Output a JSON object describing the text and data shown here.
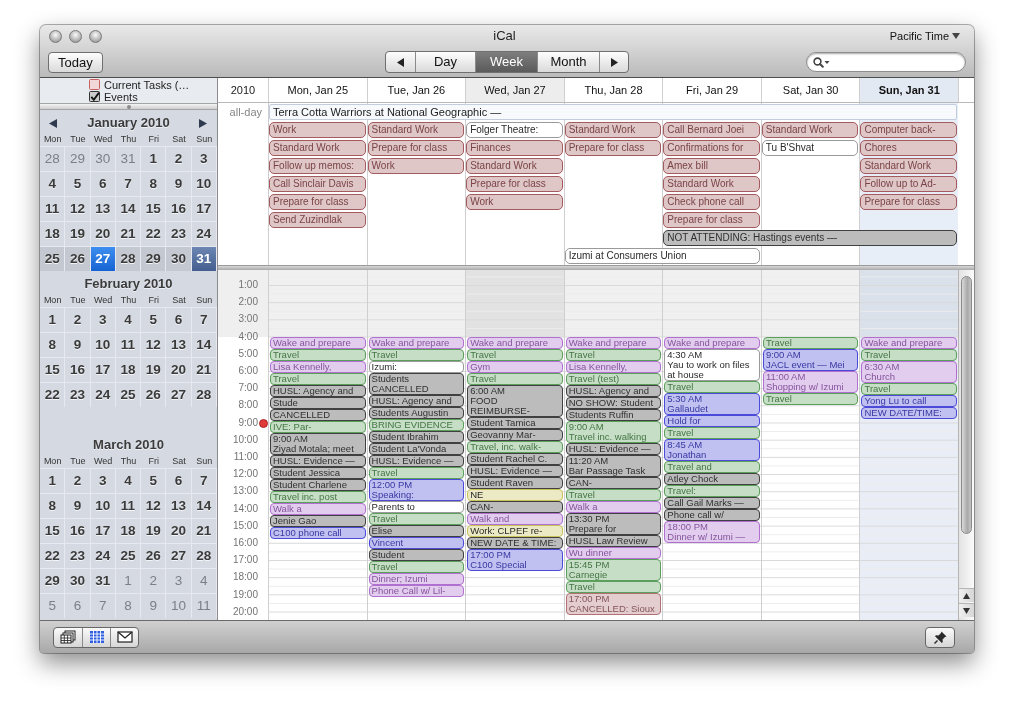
{
  "window": {
    "title": "iCal"
  },
  "toolbar": {
    "today": "Today",
    "views": [
      {
        "label": "Day",
        "selected": false
      },
      {
        "label": "Week",
        "selected": true
      },
      {
        "label": "Month",
        "selected": false
      }
    ],
    "time_zone": "Pacific Time"
  },
  "sidebar": {
    "calendars": [
      {
        "title": "Current Tasks (…",
        "checked": false,
        "color": "#c86060"
      },
      {
        "title": "Events",
        "checked": true,
        "color": "#333333"
      }
    ],
    "months": [
      {
        "title": "January 2010",
        "weekdays": [
          "Mon",
          "Tue",
          "Wed",
          "Thu",
          "Fri",
          "Sat",
          "Sun"
        ],
        "weeks": [
          {
            "in_view": false,
            "days": [
              {
                "label": "28",
                "outside": true,
                "today": false,
                "selected": false
              },
              {
                "label": "29",
                "outside": true,
                "today": false,
                "selected": false
              },
              {
                "label": "30",
                "outside": true,
                "today": false,
                "selected": false
              },
              {
                "label": "31",
                "outside": true,
                "today": false,
                "selected": false
              },
              {
                "label": "1",
                "outside": false,
                "today": false,
                "selected": false
              },
              {
                "label": "2",
                "outside": false,
                "today": false,
                "selected": false
              },
              {
                "label": "3",
                "outside": false,
                "today": false,
                "selected": false
              }
            ]
          },
          {
            "in_view": false,
            "days": [
              {
                "label": "4",
                "outside": false,
                "today": false,
                "selected": false
              },
              {
                "label": "5",
                "outside": false,
                "today": false,
                "selected": false
              },
              {
                "label": "6",
                "outside": false,
                "today": false,
                "selected": false
              },
              {
                "label": "7",
                "outside": false,
                "today": false,
                "selected": false
              },
              {
                "label": "8",
                "outside": false,
                "today": false,
                "selected": false
              },
              {
                "label": "9",
                "outside": false,
                "today": false,
                "selected": false
              },
              {
                "label": "10",
                "outside": false,
                "today": false,
                "selected": false
              }
            ]
          },
          {
            "in_view": false,
            "days": [
              {
                "label": "11",
                "outside": false,
                "today": false,
                "selected": false
              },
              {
                "label": "12",
                "outside": false,
                "today": false,
                "selected": false
              },
              {
                "label": "13",
                "outside": false,
                "today": false,
                "selected": false
              },
              {
                "label": "14",
                "outside": false,
                "today": false,
                "selected": false
              },
              {
                "label": "15",
                "outside": false,
                "today": false,
                "selected": false
              },
              {
                "label": "16",
                "outside": false,
                "today": false,
                "selected": false
              },
              {
                "label": "17",
                "outside": false,
                "today": false,
                "selected": false
              }
            ]
          },
          {
            "in_view": false,
            "days": [
              {
                "label": "18",
                "outside": false,
                "today": false,
                "selected": false
              },
              {
                "label": "19",
                "outside": false,
                "today": false,
                "selected": false
              },
              {
                "label": "20",
                "outside": false,
                "today": false,
                "selected": false
              },
              {
                "label": "21",
                "outside": false,
                "today": false,
                "selected": false
              },
              {
                "label": "22",
                "outside": false,
                "today": false,
                "selected": false
              },
              {
                "label": "23",
                "outside": false,
                "today": false,
                "selected": false
              },
              {
                "label": "24",
                "outside": false,
                "today": false,
                "selected": false
              }
            ]
          },
          {
            "in_view": true,
            "days": [
              {
                "label": "25",
                "outside": false,
                "today": false,
                "selected": false
              },
              {
                "label": "26",
                "outside": false,
                "today": false,
                "selected": false
              },
              {
                "label": "27",
                "outside": false,
                "today": true,
                "selected": false
              },
              {
                "label": "28",
                "outside": false,
                "today": false,
                "selected": false
              },
              {
                "label": "29",
                "outside": false,
                "today": false,
                "selected": false
              },
              {
                "label": "30",
                "outside": false,
                "today": false,
                "selected": false
              },
              {
                "label": "31",
                "outside": false,
                "today": false,
                "selected": true
              }
            ]
          }
        ]
      },
      {
        "title": "February 2010",
        "weekdays": [
          "Mon",
          "Tue",
          "Wed",
          "Thu",
          "Fri",
          "Sat",
          "Sun"
        ],
        "weeks": [
          {
            "in_view": false,
            "days": [
              {
                "label": "1",
                "outside": false,
                "today": false,
                "selected": false
              },
              {
                "label": "2",
                "outside": false,
                "today": false,
                "selected": false
              },
              {
                "label": "3",
                "outside": false,
                "today": false,
                "selected": false
              },
              {
                "label": "4",
                "outside": false,
                "today": false,
                "selected": false
              },
              {
                "label": "5",
                "outside": false,
                "today": false,
                "selected": false
              },
              {
                "label": "6",
                "outside": false,
                "today": false,
                "selected": false
              },
              {
                "label": "7",
                "outside": false,
                "today": false,
                "selected": false
              }
            ]
          },
          {
            "in_view": false,
            "days": [
              {
                "label": "8",
                "outside": false,
                "today": false,
                "selected": false
              },
              {
                "label": "9",
                "outside": false,
                "today": false,
                "selected": false
              },
              {
                "label": "10",
                "outside": false,
                "today": false,
                "selected": false
              },
              {
                "label": "11",
                "outside": false,
                "today": false,
                "selected": false
              },
              {
                "label": "12",
                "outside": false,
                "today": false,
                "selected": false
              },
              {
                "label": "13",
                "outside": false,
                "today": false,
                "selected": false
              },
              {
                "label": "14",
                "outside": false,
                "today": false,
                "selected": false
              }
            ]
          },
          {
            "in_view": false,
            "days": [
              {
                "label": "15",
                "outside": false,
                "today": false,
                "selected": false
              },
              {
                "label": "16",
                "outside": false,
                "today": false,
                "selected": false
              },
              {
                "label": "17",
                "outside": false,
                "today": false,
                "selected": false
              },
              {
                "label": "18",
                "outside": false,
                "today": false,
                "selected": false
              },
              {
                "label": "19",
                "outside": false,
                "today": false,
                "selected": false
              },
              {
                "label": "20",
                "outside": false,
                "today": false,
                "selected": false
              },
              {
                "label": "21",
                "outside": false,
                "today": false,
                "selected": false
              }
            ]
          },
          {
            "in_view": false,
            "days": [
              {
                "label": "22",
                "outside": false,
                "today": false,
                "selected": false
              },
              {
                "label": "23",
                "outside": false,
                "today": false,
                "selected": false
              },
              {
                "label": "24",
                "outside": false,
                "today": false,
                "selected": false
              },
              {
                "label": "25",
                "outside": false,
                "today": false,
                "selected": false
              },
              {
                "label": "26",
                "outside": false,
                "today": false,
                "selected": false
              },
              {
                "label": "27",
                "outside": false,
                "today": false,
                "selected": false
              },
              {
                "label": "28",
                "outside": false,
                "today": false,
                "selected": false
              }
            ]
          }
        ]
      },
      {
        "title": "March 2010",
        "weekdays": [
          "Mon",
          "Tue",
          "Wed",
          "Thu",
          "Fri",
          "Sat",
          "Sun"
        ],
        "weeks": [
          {
            "in_view": false,
            "days": [
              {
                "label": "1",
                "outside": false,
                "today": false,
                "selected": false
              },
              {
                "label": "2",
                "outside": false,
                "today": false,
                "selected": false
              },
              {
                "label": "3",
                "outside": false,
                "today": false,
                "selected": false
              },
              {
                "label": "4",
                "outside": false,
                "today": false,
                "selected": false
              },
              {
                "label": "5",
                "outside": false,
                "today": false,
                "selected": false
              },
              {
                "label": "6",
                "outside": false,
                "today": false,
                "selected": false
              },
              {
                "label": "7",
                "outside": false,
                "today": false,
                "selected": false
              }
            ]
          },
          {
            "in_view": false,
            "days": [
              {
                "label": "8",
                "outside": false,
                "today": false,
                "selected": false
              },
              {
                "label": "9",
                "outside": false,
                "today": false,
                "selected": false
              },
              {
                "label": "10",
                "outside": false,
                "today": false,
                "selected": false
              },
              {
                "label": "11",
                "outside": false,
                "today": false,
                "selected": false
              },
              {
                "label": "12",
                "outside": false,
                "today": false,
                "selected": false
              },
              {
                "label": "13",
                "outside": false,
                "today": false,
                "selected": false
              },
              {
                "label": "14",
                "outside": false,
                "today": false,
                "selected": false
              }
            ]
          },
          {
            "in_view": false,
            "days": [
              {
                "label": "15",
                "outside": false,
                "today": false,
                "selected": false
              },
              {
                "label": "16",
                "outside": false,
                "today": false,
                "selected": false
              },
              {
                "label": "17",
                "outside": false,
                "today": false,
                "selected": false
              },
              {
                "label": "18",
                "outside": false,
                "today": false,
                "selected": false
              },
              {
                "label": "19",
                "outside": false,
                "today": false,
                "selected": false
              },
              {
                "label": "20",
                "outside": false,
                "today": false,
                "selected": false
              },
              {
                "label": "21",
                "outside": false,
                "today": false,
                "selected": false
              }
            ]
          },
          {
            "in_view": false,
            "days": [
              {
                "label": "22",
                "outside": false,
                "today": false,
                "selected": false
              },
              {
                "label": "23",
                "outside": false,
                "today": false,
                "selected": false
              },
              {
                "label": "24",
                "outside": false,
                "today": false,
                "selected": false
              },
              {
                "label": "25",
                "outside": false,
                "today": false,
                "selected": false
              },
              {
                "label": "26",
                "outside": false,
                "today": false,
                "selected": false
              },
              {
                "label": "27",
                "outside": false,
                "today": false,
                "selected": false
              },
              {
                "label": "28",
                "outside": false,
                "today": false,
                "selected": false
              }
            ]
          },
          {
            "in_view": false,
            "days": [
              {
                "label": "29",
                "outside": false,
                "today": false,
                "selected": false
              },
              {
                "label": "30",
                "outside": false,
                "today": false,
                "selected": false
              },
              {
                "label": "31",
                "outside": false,
                "today": false,
                "selected": false
              },
              {
                "label": "1",
                "outside": true,
                "today": false,
                "selected": false
              },
              {
                "label": "2",
                "outside": true,
                "today": false,
                "selected": false
              },
              {
                "label": "3",
                "outside": true,
                "today": false,
                "selected": false
              },
              {
                "label": "4",
                "outside": true,
                "today": false,
                "selected": false
              }
            ]
          },
          {
            "in_view": false,
            "days": [
              {
                "label": "5",
                "outside": true,
                "today": false,
                "selected": false
              },
              {
                "label": "6",
                "outside": true,
                "today": false,
                "selected": false
              },
              {
                "label": "7",
                "outside": true,
                "today": false,
                "selected": false
              },
              {
                "label": "8",
                "outside": true,
                "today": false,
                "selected": false
              },
              {
                "label": "9",
                "outside": true,
                "today": false,
                "selected": false
              },
              {
                "label": "10",
                "outside": true,
                "today": false,
                "selected": false
              },
              {
                "label": "11",
                "outside": true,
                "today": false,
                "selected": false
              }
            ]
          }
        ]
      }
    ]
  },
  "week": {
    "year": "2010",
    "all_day_label": "all-day",
    "ongoing": {
      "title": "Terra Cotta Warriors at National Geographic —"
    },
    "days": [
      {
        "label": "Mon, Jan 25",
        "today": false,
        "selected": false,
        "all_day": [
          {
            "kind": "single",
            "title": "Work",
            "color": "#a35b5f"
          },
          {
            "kind": "single",
            "title": "Standard Work",
            "color": "#a35b5f"
          },
          {
            "kind": "single",
            "title": "Follow up memos:",
            "color": "#a35b5f"
          },
          {
            "kind": "single",
            "title": "Call Sinclair Davis",
            "color": "#a35b5f"
          },
          {
            "kind": "single",
            "title": "Prepare for class",
            "color": "#a35b5f"
          },
          {
            "kind": "single",
            "title": "Send Zuzindlak",
            "color": "#a35b5f"
          }
        ],
        "events": [
          {
            "title": "Wake and prepare",
            "color": "#b070d0"
          },
          {
            "title": "Travel",
            "color": "#5c9e5c"
          },
          {
            "title": "Lisa Kennelly,",
            "color": "#b070d0"
          },
          {
            "title": "Travel",
            "color": "#5c9e5c"
          },
          {
            "title": "HUSL: Agency and",
            "color": "#404040"
          },
          {
            "title": "Stude",
            "color": "#404040"
          },
          {
            "title": "CANCELLED",
            "color": "#404040"
          },
          {
            "title": "IVE: Par-",
            "color": "#5c9e5c"
          },
          {
            "time": "9:00 AM",
            "title": "Ziyad Motala; meet",
            "color": "#404040"
          },
          {
            "title": "HUSL: Evidence —",
            "color": "#404040"
          },
          {
            "title": "Student Jessica",
            "color": "#404040"
          },
          {
            "title": "Student Charlene",
            "color": "#404040"
          },
          {
            "title": "Travel inc. post",
            "color": "#5c9e5c"
          },
          {
            "title": "Walk a",
            "color": "#b070d0"
          },
          {
            "title": "Jenie Gao",
            "color": "#404040"
          },
          {
            "title": "C100 phone call",
            "color": "#4b4bd8"
          }
        ]
      },
      {
        "label": "Tue, Jan 26",
        "today": false,
        "selected": false,
        "all_day": [
          {
            "kind": "single",
            "title": "Standard Work",
            "color": "#a35b5f"
          },
          {
            "kind": "single",
            "title": "Prepare for class",
            "color": "#a35b5f"
          },
          {
            "kind": "single",
            "title": "Work",
            "color": "#a35b5f"
          }
        ],
        "events": [
          {
            "title": "Wake and prepare",
            "color": "#b070d0"
          },
          {
            "title": "Travel",
            "color": "#5c9e5c"
          },
          {
            "title": "Izumi:",
            "color": "#ffffff"
          },
          {
            "title": "Students CANCELLED",
            "color": "#404040"
          },
          {
            "title": "HUSL: Agency and",
            "color": "#404040"
          },
          {
            "title": "Students Augustin",
            "color": "#404040"
          },
          {
            "title": "BRING EVIDENCE",
            "color": "#5c9e5c"
          },
          {
            "title": "Student Ibrahim",
            "color": "#404040"
          },
          {
            "title": "Student La'Vonda",
            "color": "#404040"
          },
          {
            "title": "HUSL: Evidence —",
            "color": "#404040"
          },
          {
            "title": "Travel",
            "color": "#5c9e5c"
          },
          {
            "time": "12:00 PM",
            "title": "Speaking:",
            "color": "#4b4bd8"
          },
          {
            "title": "Parents to",
            "color": "#ffffff"
          },
          {
            "title": "Travel",
            "color": "#5c9e5c"
          },
          {
            "title": "Elise",
            "color": "#404040"
          },
          {
            "title": "Vincent",
            "color": "#4b4bd8"
          },
          {
            "title": "Student",
            "color": "#404040"
          },
          {
            "title": "Travel",
            "color": "#5c9e5c"
          },
          {
            "title": "Dinner; Izumi",
            "color": "#b070d0"
          },
          {
            "title": "Phone Call w/ Lil-",
            "color": "#b070d0"
          }
        ]
      },
      {
        "label": "Wed, Jan 27",
        "today": true,
        "selected": false,
        "all_day": [
          {
            "kind": "single",
            "title": "Folger Theatre:",
            "color": "#ffffff"
          },
          {
            "kind": "single",
            "title": "Finances",
            "color": "#a35b5f"
          },
          {
            "kind": "single",
            "title": "Standard Work",
            "color": "#a35b5f"
          },
          {
            "kind": "single",
            "title": "Prepare for class",
            "color": "#a35b5f"
          },
          {
            "kind": "single",
            "title": "Work",
            "color": "#a35b5f"
          }
        ],
        "events": [
          {
            "title": "Wake and prepare",
            "color": "#b070d0"
          },
          {
            "title": "Travel",
            "color": "#5c9e5c"
          },
          {
            "title": "Gym",
            "color": "#b070d0"
          },
          {
            "title": "Travel",
            "color": "#5c9e5c"
          },
          {
            "time": "6:00 AM",
            "title": "FOOD REIMBURSE-",
            "color": "#404040"
          },
          {
            "title": "Student Tamica",
            "color": "#404040"
          },
          {
            "title": "Geovanny Mar-",
            "color": "#404040"
          },
          {
            "title": "Travel, inc. walk-",
            "color": "#5c9e5c"
          },
          {
            "title": "Student Rachel C.",
            "color": "#404040"
          },
          {
            "title": "HUSL: Evidence —",
            "color": "#404040"
          },
          {
            "title": "Student Raven",
            "color": "#404040"
          },
          {
            "title": "NE",
            "color": "#c9c25a"
          },
          {
            "title": "CAN-",
            "color": "#404040"
          },
          {
            "title": "Walk and",
            "color": "#b070d0"
          },
          {
            "title": "Work: CLPEF re-",
            "color": "#c9c25a"
          },
          {
            "title": "NEW DATE & TIME:",
            "color": "#404040"
          },
          {
            "time": "17:00 PM",
            "title": "C100 Special",
            "color": "#4b4bd8"
          }
        ]
      },
      {
        "label": "Thu, Jan 28",
        "today": false,
        "selected": false,
        "all_day": [
          {
            "kind": "single",
            "title": "Standard Work",
            "color": "#a35b5f"
          },
          {
            "kind": "single",
            "title": "Prepare for class",
            "color": "#a35b5f"
          },
          {
            "kind": "twoday",
            "title": "Izumi at Consumers Union",
            "color": "#ffffff"
          }
        ],
        "events": [
          {
            "title": "Wake and prepare",
            "color": "#b070d0"
          },
          {
            "title": "Travel",
            "color": "#5c9e5c"
          },
          {
            "title": "Lisa Kennelly,",
            "color": "#b070d0"
          },
          {
            "title": "Travel (test)",
            "color": "#5c9e5c"
          },
          {
            "title": "HUSL: Agency and",
            "color": "#404040"
          },
          {
            "title": "NO SHOW: Student",
            "color": "#404040"
          },
          {
            "title": "Students Ruffin",
            "color": "#404040"
          },
          {
            "time": "9:00 AM",
            "title": "Travel inc. walking",
            "color": "#5c9e5c"
          },
          {
            "title": "HUSL: Evidence —",
            "color": "#404040"
          },
          {
            "time": "11:20 AM",
            "title": "Bar Passage Task",
            "color": "#404040"
          },
          {
            "title": "CAN-",
            "color": "#404040"
          },
          {
            "title": "Travel",
            "color": "#5c9e5c"
          },
          {
            "title": "Walk a",
            "color": "#b070d0"
          },
          {
            "time": "13:30 PM",
            "title": "Prepare for",
            "color": "#404040"
          },
          {
            "title": "HUSL Law Review",
            "color": "#404040"
          },
          {
            "title": "Wu dinner",
            "color": "#b070d0"
          },
          {
            "time": "15:45 PM",
            "title": "Carnegie",
            "color": "#5c9e5c"
          },
          {
            "title": "Travel",
            "color": "#5c9e5c"
          },
          {
            "time": "17:00 PM",
            "title": "CANCELLED: Sioux",
            "color": "#b07076"
          }
        ]
      },
      {
        "label": "Fri, Jan 29",
        "today": false,
        "selected": false,
        "all_day": [
          {
            "kind": "single",
            "title": "Call Bernard Joei",
            "color": "#a35b5f"
          },
          {
            "kind": "single",
            "title": "Confirmations for",
            "color": "#a35b5f"
          },
          {
            "kind": "single",
            "title": "Amex bill",
            "color": "#a35b5f"
          },
          {
            "kind": "single",
            "title": "Standard Work",
            "color": "#a35b5f"
          },
          {
            "kind": "single",
            "title": "Check phone call",
            "color": "#a35b5f"
          },
          {
            "kind": "single",
            "title": "Prepare for class",
            "color": "#a35b5f"
          },
          {
            "kind": "threeday",
            "title": "NOT ATTENDING: Hastings events —",
            "color": "#404040"
          }
        ],
        "events": [
          {
            "title": "Wake and prepare",
            "color": "#b070d0"
          },
          {
            "time": "4:30 AM",
            "title": "Yau to work on files at house",
            "color": "#ffffff"
          },
          {
            "title": "Travel",
            "color": "#5c9e5c"
          },
          {
            "time": "5:30 AM",
            "title": "Gallaudet",
            "color": "#4b4bd8"
          },
          {
            "title": "Hold for",
            "color": "#4b4bd8"
          },
          {
            "title": "Travel",
            "color": "#5c9e5c"
          },
          {
            "time": "8:45 AM",
            "title": "Jonathan",
            "color": "#4b4bd8"
          },
          {
            "title": "Travel and",
            "color": "#5c9e5c"
          },
          {
            "title": "Atley Chock",
            "color": "#404040"
          },
          {
            "title": "Travel:",
            "color": "#5c9e5c"
          },
          {
            "title": "Call Gail Marks —",
            "color": "#404040"
          },
          {
            "title": "Phone call w/",
            "color": "#404040"
          },
          {
            "time": "18:00 PM",
            "title": "Dinner w/ Izumi —",
            "color": "#b070d0"
          }
        ]
      },
      {
        "label": "Sat, Jan 30",
        "today": false,
        "selected": false,
        "all_day": [
          {
            "kind": "single",
            "title": "Standard Work",
            "color": "#a35b5f"
          },
          {
            "kind": "single",
            "title": "Tu B'Shvat",
            "color": "#ffffff"
          }
        ],
        "events": [
          {
            "title": "Travel",
            "color": "#5c9e5c"
          },
          {
            "time": "9:00 AM",
            "title": "JACL event — Mei",
            "color": "#4b4bd8"
          },
          {
            "time": "11:00 AM",
            "title": "Shopping w/ Izumi",
            "color": "#b070d0"
          },
          {
            "title": "Travel",
            "color": "#5c9e5c"
          }
        ]
      },
      {
        "label": "Sun, Jan 31",
        "today": false,
        "selected": true,
        "all_day": [
          {
            "kind": "single",
            "title": "Computer back-",
            "color": "#a35b5f"
          },
          {
            "kind": "single",
            "title": "Chores",
            "color": "#a35b5f"
          },
          {
            "kind": "single",
            "title": "Standard Work",
            "color": "#a35b5f"
          },
          {
            "kind": "single",
            "title": "Follow up to Ad-",
            "color": "#a35b5f"
          },
          {
            "kind": "single",
            "title": "Prepare for class",
            "color": "#a35b5f"
          }
        ],
        "events": [
          {
            "title": "Wake and prepare",
            "color": "#b070d0"
          },
          {
            "title": "Travel",
            "color": "#5c9e5c"
          },
          {
            "time": "6:30 AM",
            "title": "Church",
            "color": "#b070d0"
          },
          {
            "title": "Travel",
            "color": "#5c9e5c"
          },
          {
            "title": "Yong Lu to call",
            "color": "#4b4bd8"
          },
          {
            "title": "NEW DATE/TIME:",
            "color": "#4b4bd8"
          }
        ]
      }
    ],
    "hours": [
      {
        "label": "1:00",
        "off_hours": true,
        "current": false
      },
      {
        "label": "2:00",
        "off_hours": true,
        "current": false
      },
      {
        "label": "3:00",
        "off_hours": true,
        "current": false
      },
      {
        "label": "4:00",
        "off_hours": false,
        "current": false
      },
      {
        "label": "5:00",
        "off_hours": false,
        "current": false
      },
      {
        "label": "6:00",
        "off_hours": false,
        "current": false
      },
      {
        "label": "7:00",
        "off_hours": false,
        "current": false
      },
      {
        "label": "8:00",
        "off_hours": false,
        "current": false
      },
      {
        "label": "9:00",
        "off_hours": false,
        "current": true
      },
      {
        "label": "10:00",
        "off_hours": false,
        "current": false
      },
      {
        "label": "11:00",
        "off_hours": false,
        "current": false
      },
      {
        "label": "12:00",
        "off_hours": false,
        "current": false
      },
      {
        "label": "13:00",
        "off_hours": false,
        "current": false
      },
      {
        "label": "14:00",
        "off_hours": false,
        "current": false
      },
      {
        "label": "15:00",
        "off_hours": false,
        "current": false
      },
      {
        "label": "16:00",
        "off_hours": false,
        "current": false
      },
      {
        "label": "17:00",
        "off_hours": false,
        "current": false
      },
      {
        "label": "18:00",
        "off_hours": false,
        "current": false
      },
      {
        "label": "19:00",
        "off_hours": false,
        "current": false
      },
      {
        "label": "20:00",
        "off_hours": false,
        "current": false
      }
    ]
  },
  "bottom_bar": {
    "toggles": [
      {
        "on": false
      },
      {
        "on": true
      },
      {
        "on": false
      }
    ]
  }
}
